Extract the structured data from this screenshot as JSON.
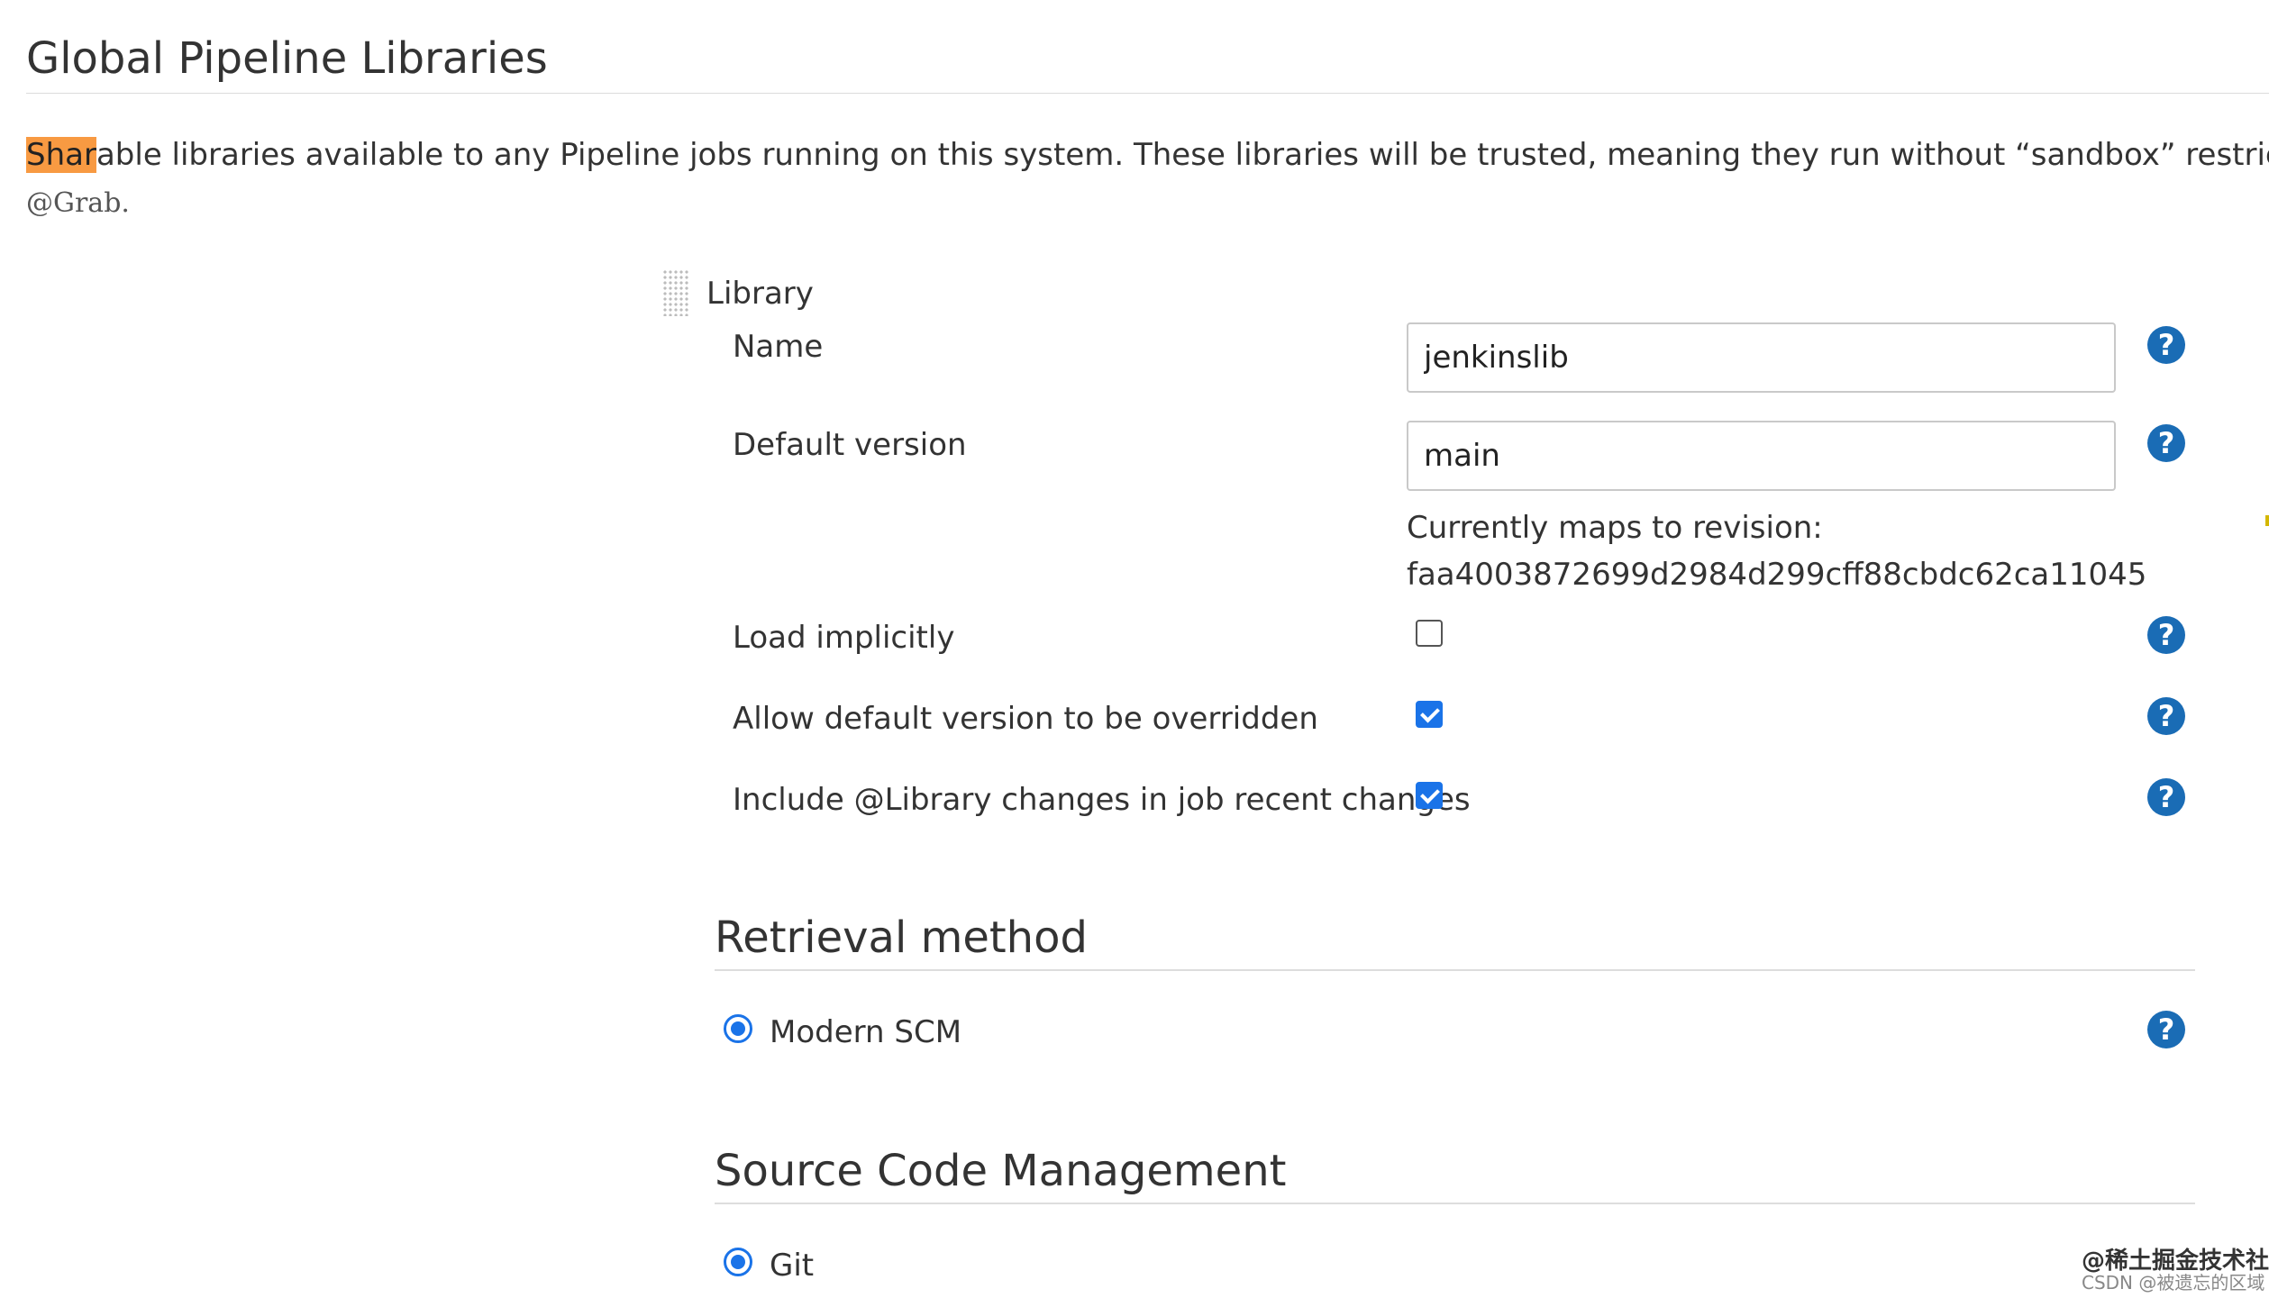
{
  "page": {
    "title": "Global Pipeline Libraries",
    "description_highlight": "Shar",
    "description_rest": "able libraries available to any Pipeline jobs running on this system. These libraries will be trusted, meaning they run without “sandbox” restrictions and may us",
    "description_code": "@Grab",
    "description_tail": "."
  },
  "library": {
    "header": "Library",
    "name_label": "Name",
    "name_value": "jenkinslib",
    "default_version_label": "Default version",
    "default_version_value": "main",
    "revision_label": "Currently maps to revision:",
    "revision_hash": "faa4003872699d2984d299cff88cbdc62ca11045",
    "load_implicitly_label": "Load implicitly",
    "load_implicitly_checked": false,
    "allow_override_label": "Allow default version to be overridden",
    "allow_override_checked": true,
    "include_changes_label": "Include @Library changes in job recent changes",
    "include_changes_checked": true
  },
  "retrieval": {
    "title": "Retrieval method",
    "option_label": "Modern SCM",
    "option_selected": true
  },
  "scm": {
    "title": "Source Code Management",
    "option_label": "Git",
    "option_selected": true
  },
  "help_icon_glyph": "?",
  "colors": {
    "accent": "#1a73e8",
    "help": "#1a6cb5",
    "highlight": "#f89a42"
  },
  "watermark": {
    "line1": "@稀土掘金技术社区",
    "line2": "CSDN @被遗忘的区域"
  }
}
